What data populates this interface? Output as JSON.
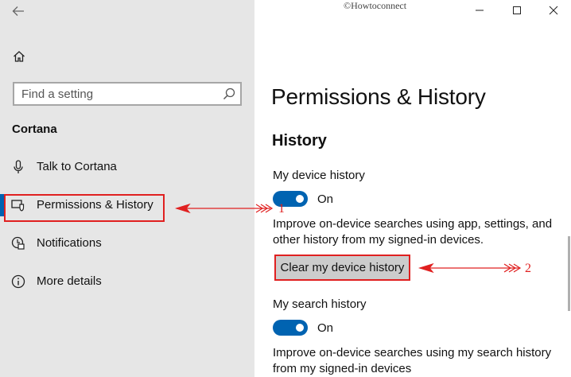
{
  "watermark": "©Howtoconnect",
  "sidebar": {
    "search_placeholder": "Find a setting",
    "section_title": "Cortana",
    "items": [
      {
        "label": "Talk to Cortana"
      },
      {
        "label": "Permissions & History"
      },
      {
        "label": "Notifications"
      },
      {
        "label": "More details"
      }
    ]
  },
  "main": {
    "page_title": "Permissions & History",
    "section_heading": "History",
    "device_history": {
      "label": "My device history",
      "toggle_state": "On",
      "description_line1": "Improve on-device searches using app, settings, and",
      "description_line2": "other history from my signed-in devices.",
      "clear_button": "Clear my device history"
    },
    "search_history": {
      "label": "My search history",
      "toggle_state": "On",
      "description_line1": "Improve on-device searches using my search history",
      "description_line2": "from my signed-in devices"
    }
  },
  "annotations": {
    "marker_1": "1",
    "marker_2": "2"
  },
  "colors": {
    "accent": "#0063b1",
    "annotation": "#e02020",
    "sidebar_bg": "#e6e6e6"
  }
}
